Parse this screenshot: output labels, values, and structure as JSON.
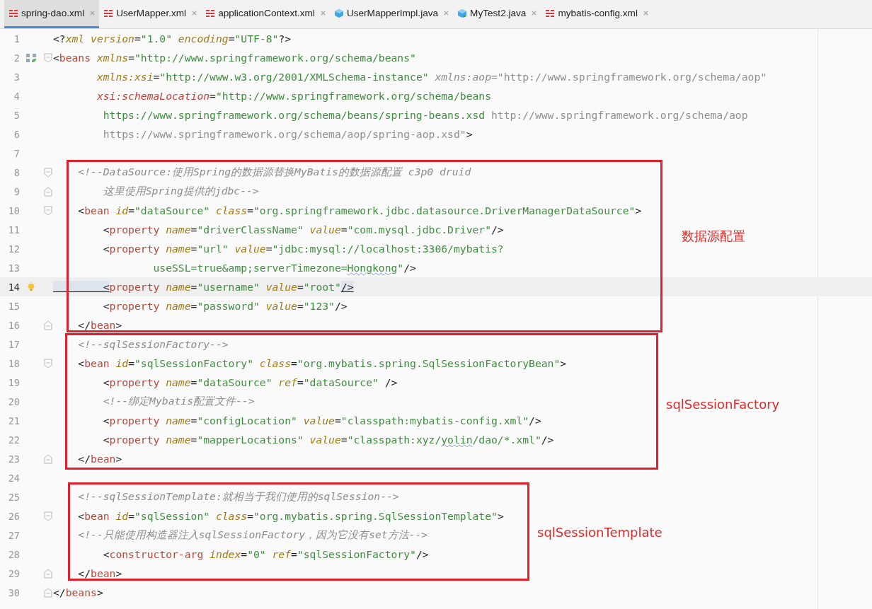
{
  "tabs": [
    {
      "label": "spring-dao.xml",
      "kind": "xml",
      "selected": true
    },
    {
      "label": "UserMapper.xml",
      "kind": "xml",
      "selected": false
    },
    {
      "label": "applicationContext.xml",
      "kind": "xml",
      "selected": false
    },
    {
      "label": "UserMapperImpl.java",
      "kind": "java-class",
      "selected": false
    },
    {
      "label": "MyTest2.java",
      "kind": "java-runnable",
      "selected": false
    },
    {
      "label": "mybatis-config.xml",
      "kind": "xml",
      "selected": false
    }
  ],
  "sections": [
    {
      "lines": [
        {
          "n": "1",
          "tokens": [
            {
              "kind": "p",
              "text": "<?"
            },
            {
              "kind": "attr",
              "text": "xml"
            },
            {
              "kind": "attr",
              "text": " version"
            },
            {
              "kind": "p",
              "text": "="
            },
            {
              "kind": "val",
              "text": "\"1.0\""
            },
            {
              "kind": "attr",
              "text": " encoding"
            },
            {
              "kind": "p",
              "text": "="
            },
            {
              "kind": "val",
              "text": "\"UTF-8\""
            },
            {
              "kind": "p",
              "text": "?>"
            }
          ]
        },
        {
          "n": "2",
          "gutter": {
            "kind": "bean"
          },
          "fold": {
            "kind": "start"
          },
          "tokens": [
            {
              "kind": "p",
              "text": "<"
            },
            {
              "kind": "tag",
              "text": "beans"
            },
            {
              "kind": "attr",
              "text": " xmlns"
            },
            {
              "kind": "p",
              "text": "="
            },
            {
              "kind": "val",
              "text": "\"http://www.springframework.org/schema/beans\""
            }
          ]
        },
        {
          "n": "3",
          "tokens": [
            {
              "kind": "attr",
              "text": "       xmlns:xsi"
            },
            {
              "kind": "p",
              "text": "="
            },
            {
              "kind": "val",
              "text": "\"http://www.w3.org/2001/XMLSchema-instance\""
            },
            {
              "kind": "grey-attr",
              "text": " xmlns:aop"
            },
            {
              "kind": "grey",
              "text": "=\"http://www.springframework.org/schema/aop\""
            }
          ]
        },
        {
          "n": "4",
          "tokens": [
            {
              "kind": "attr-red",
              "text": "       xsi:schemaLocation"
            },
            {
              "kind": "p",
              "text": "="
            },
            {
              "kind": "val",
              "text": "\"http://www.springframework.org/schema/beans"
            }
          ]
        },
        {
          "n": "5",
          "tokens": [
            {
              "kind": "val",
              "text": "        https://www.springframework.org/schema/beans/spring-beans.xsd"
            },
            {
              "kind": "grey",
              "text": " http://www.springframework.org/schema/aop"
            }
          ]
        },
        {
          "n": "6",
          "tokens": [
            {
              "kind": "grey",
              "text": "        https://www.springframework.org/schema/aop/spring-aop.xsd\""
            },
            {
              "kind": "p",
              "text": ">"
            }
          ]
        },
        {
          "n": "7"
        }
      ]
    },
    {
      "annotation": "数据源配置",
      "lines": [
        {
          "n": "8",
          "fold": {
            "kind": "start"
          },
          "tokens": [
            {
              "kind": "comment",
              "text": "    <!--DataSource:使用Spring的数据源替换MyBatis的数据源配置 c3p0 druid"
            }
          ]
        },
        {
          "n": "9",
          "fold": {
            "kind": "end"
          },
          "tokens": [
            {
              "kind": "comment",
              "text": "        这里使用Spring提供的jdbc-->"
            }
          ]
        },
        {
          "n": "10",
          "fold": {
            "kind": "start"
          },
          "tokens": [
            {
              "kind": "p",
              "text": "    <"
            },
            {
              "kind": "tag",
              "text": "bean"
            },
            {
              "kind": "attr",
              "text": " id"
            },
            {
              "kind": "p",
              "text": "="
            },
            {
              "kind": "val",
              "text": "\"dataSource\""
            },
            {
              "kind": "attr",
              "text": " class"
            },
            {
              "kind": "p",
              "text": "="
            },
            {
              "kind": "val",
              "text": "\"org.springframework.jdbc.datasource.DriverManagerDataSource\""
            },
            {
              "kind": "p",
              "text": ">"
            }
          ]
        },
        {
          "n": "11",
          "tokens": [
            {
              "kind": "p",
              "text": "        <"
            },
            {
              "kind": "tag",
              "text": "property"
            },
            {
              "kind": "attr",
              "text": " name"
            },
            {
              "kind": "p",
              "text": "="
            },
            {
              "kind": "val",
              "text": "\"driverClassName\""
            },
            {
              "kind": "attr",
              "text": " value"
            },
            {
              "kind": "p",
              "text": "="
            },
            {
              "kind": "val",
              "text": "\"com.mysql.jdbc.Driver\""
            },
            {
              "kind": "p",
              "text": "/>"
            }
          ]
        },
        {
          "n": "12",
          "tokens": [
            {
              "kind": "p",
              "text": "        <"
            },
            {
              "kind": "tag",
              "text": "property"
            },
            {
              "kind": "attr",
              "text": " name"
            },
            {
              "kind": "p",
              "text": "="
            },
            {
              "kind": "val",
              "text": "\"url\""
            },
            {
              "kind": "attr",
              "text": " value"
            },
            {
              "kind": "p",
              "text": "="
            },
            {
              "kind": "val",
              "text": "\"jdbc:mysql://localhost:3306/mybatis?"
            }
          ]
        },
        {
          "n": "13",
          "tokens": [
            {
              "kind": "val",
              "text": "                useSSL=true&amp;serverTimezone="
            },
            {
              "kind": "typo",
              "text": "Hongkong"
            },
            {
              "kind": "val",
              "text": "\""
            },
            {
              "kind": "p",
              "text": "/>"
            }
          ]
        },
        {
          "n": "14",
          "current": true,
          "gutter": {
            "kind": "bulb"
          },
          "tokens": [
            {
              "kind": "match",
              "text": "        <"
            },
            {
              "kind": "tag",
              "text": "property"
            },
            {
              "kind": "attr",
              "text": " name"
            },
            {
              "kind": "p",
              "text": "="
            },
            {
              "kind": "val",
              "text": "\"username\""
            },
            {
              "kind": "attr",
              "text": " value"
            },
            {
              "kind": "p",
              "text": "="
            },
            {
              "kind": "val",
              "text": "\"root\""
            },
            {
              "kind": "match",
              "text": "/>"
            }
          ]
        },
        {
          "n": "15",
          "tokens": [
            {
              "kind": "p",
              "text": "        <"
            },
            {
              "kind": "tag",
              "text": "property"
            },
            {
              "kind": "attr",
              "text": " name"
            },
            {
              "kind": "p",
              "text": "="
            },
            {
              "kind": "val",
              "text": "\"password\""
            },
            {
              "kind": "attr",
              "text": " value"
            },
            {
              "kind": "p",
              "text": "="
            },
            {
              "kind": "val",
              "text": "\"123\""
            },
            {
              "kind": "p",
              "text": "/>"
            }
          ]
        },
        {
          "n": "16",
          "fold": {
            "kind": "end"
          },
          "tokens": [
            {
              "kind": "p",
              "text": "    </"
            },
            {
              "kind": "tag",
              "text": "bean"
            },
            {
              "kind": "p",
              "text": ">"
            }
          ]
        }
      ]
    },
    {
      "annotation": "sqlSessionFactory",
      "lines": [
        {
          "n": "17",
          "tokens": [
            {
              "kind": "comment",
              "text": "    <!--sqlSessionFactory-->"
            }
          ]
        },
        {
          "n": "18",
          "fold": {
            "kind": "start"
          },
          "tokens": [
            {
              "kind": "p",
              "text": "    <"
            },
            {
              "kind": "tag",
              "text": "bean"
            },
            {
              "kind": "attr",
              "text": " id"
            },
            {
              "kind": "p",
              "text": "="
            },
            {
              "kind": "val",
              "text": "\"sqlSessionFactory\""
            },
            {
              "kind": "attr",
              "text": " class"
            },
            {
              "kind": "p",
              "text": "="
            },
            {
              "kind": "val",
              "text": "\"org.mybatis.spring.SqlSessionFactoryBean\""
            },
            {
              "kind": "p",
              "text": ">"
            }
          ]
        },
        {
          "n": "19",
          "tokens": [
            {
              "kind": "p",
              "text": "        <"
            },
            {
              "kind": "tag",
              "text": "property"
            },
            {
              "kind": "attr",
              "text": " name"
            },
            {
              "kind": "p",
              "text": "="
            },
            {
              "kind": "val",
              "text": "\"dataSource\""
            },
            {
              "kind": "attr",
              "text": " ref"
            },
            {
              "kind": "p",
              "text": "="
            },
            {
              "kind": "val",
              "text": "\"dataSource\""
            },
            {
              "kind": "p",
              "text": " />"
            }
          ]
        },
        {
          "n": "20",
          "tokens": [
            {
              "kind": "comment",
              "text": "        <!--绑定Mybatis配置文件-->"
            }
          ]
        },
        {
          "n": "21",
          "tokens": [
            {
              "kind": "p",
              "text": "        <"
            },
            {
              "kind": "tag",
              "text": "property"
            },
            {
              "kind": "attr",
              "text": " name"
            },
            {
              "kind": "p",
              "text": "="
            },
            {
              "kind": "val",
              "text": "\"configLocation\""
            },
            {
              "kind": "attr",
              "text": " value"
            },
            {
              "kind": "p",
              "text": "="
            },
            {
              "kind": "val",
              "text": "\"classpath:mybatis-config.xml\""
            },
            {
              "kind": "p",
              "text": "/>"
            }
          ]
        },
        {
          "n": "22",
          "tokens": [
            {
              "kind": "p",
              "text": "        <"
            },
            {
              "kind": "tag",
              "text": "property"
            },
            {
              "kind": "attr",
              "text": " name"
            },
            {
              "kind": "p",
              "text": "="
            },
            {
              "kind": "val",
              "text": "\"mapperLocations\""
            },
            {
              "kind": "attr",
              "text": " value"
            },
            {
              "kind": "p",
              "text": "="
            },
            {
              "kind": "val",
              "text": "\"classpath:xyz/"
            },
            {
              "kind": "typo",
              "text": "yolin"
            },
            {
              "kind": "val",
              "text": "/dao/*.xml\""
            },
            {
              "kind": "p",
              "text": "/>"
            }
          ]
        },
        {
          "n": "23",
          "fold": {
            "kind": "end"
          },
          "tokens": [
            {
              "kind": "p",
              "text": "    </"
            },
            {
              "kind": "tag",
              "text": "bean"
            },
            {
              "kind": "p",
              "text": ">"
            }
          ]
        }
      ]
    },
    {
      "lines": [
        {
          "n": "24"
        }
      ]
    },
    {
      "annotation": "sqlSessionTemplate",
      "lines": [
        {
          "n": "25",
          "tokens": [
            {
              "kind": "comment",
              "text": "    <!--sqlSessionTemplate:就相当于我们使用的sqlSession-->"
            }
          ]
        },
        {
          "n": "26",
          "fold": {
            "kind": "start"
          },
          "tokens": [
            {
              "kind": "p",
              "text": "    <"
            },
            {
              "kind": "tag",
              "text": "bean"
            },
            {
              "kind": "attr",
              "text": " id"
            },
            {
              "kind": "p",
              "text": "="
            },
            {
              "kind": "val",
              "text": "\"sqlSession\""
            },
            {
              "kind": "attr",
              "text": " class"
            },
            {
              "kind": "p",
              "text": "="
            },
            {
              "kind": "val",
              "text": "\"org.mybatis.spring.SqlSessionTemplate\""
            },
            {
              "kind": "p",
              "text": ">"
            }
          ]
        },
        {
          "n": "27",
          "tokens": [
            {
              "kind": "comment",
              "text": "    <!--只能使用构造器注入sqlSessionFactory，因为它没有set方法-->"
            }
          ]
        },
        {
          "n": "28",
          "tokens": [
            {
              "kind": "p",
              "text": "        <"
            },
            {
              "kind": "tag",
              "text": "constructor-arg"
            },
            {
              "kind": "attr",
              "text": " index"
            },
            {
              "kind": "p",
              "text": "="
            },
            {
              "kind": "val",
              "text": "\"0\""
            },
            {
              "kind": "attr",
              "text": " ref"
            },
            {
              "kind": "p",
              "text": "="
            },
            {
              "kind": "val",
              "text": "\"sqlSessionFactory\""
            },
            {
              "kind": "p",
              "text": "/>"
            }
          ]
        },
        {
          "n": "29",
          "fold": {
            "kind": "end"
          },
          "tokens": [
            {
              "kind": "p",
              "text": "    </"
            },
            {
              "kind": "tag",
              "text": "bean"
            },
            {
              "kind": "p",
              "text": ">"
            }
          ]
        }
      ]
    },
    {
      "lines": [
        {
          "n": "30",
          "fold": {
            "kind": "end"
          },
          "tokens": [
            {
              "kind": "p",
              "text": "</"
            },
            {
              "kind": "tag",
              "text": "beans"
            },
            {
              "kind": "p",
              "text": ">"
            }
          ]
        }
      ]
    }
  ]
}
